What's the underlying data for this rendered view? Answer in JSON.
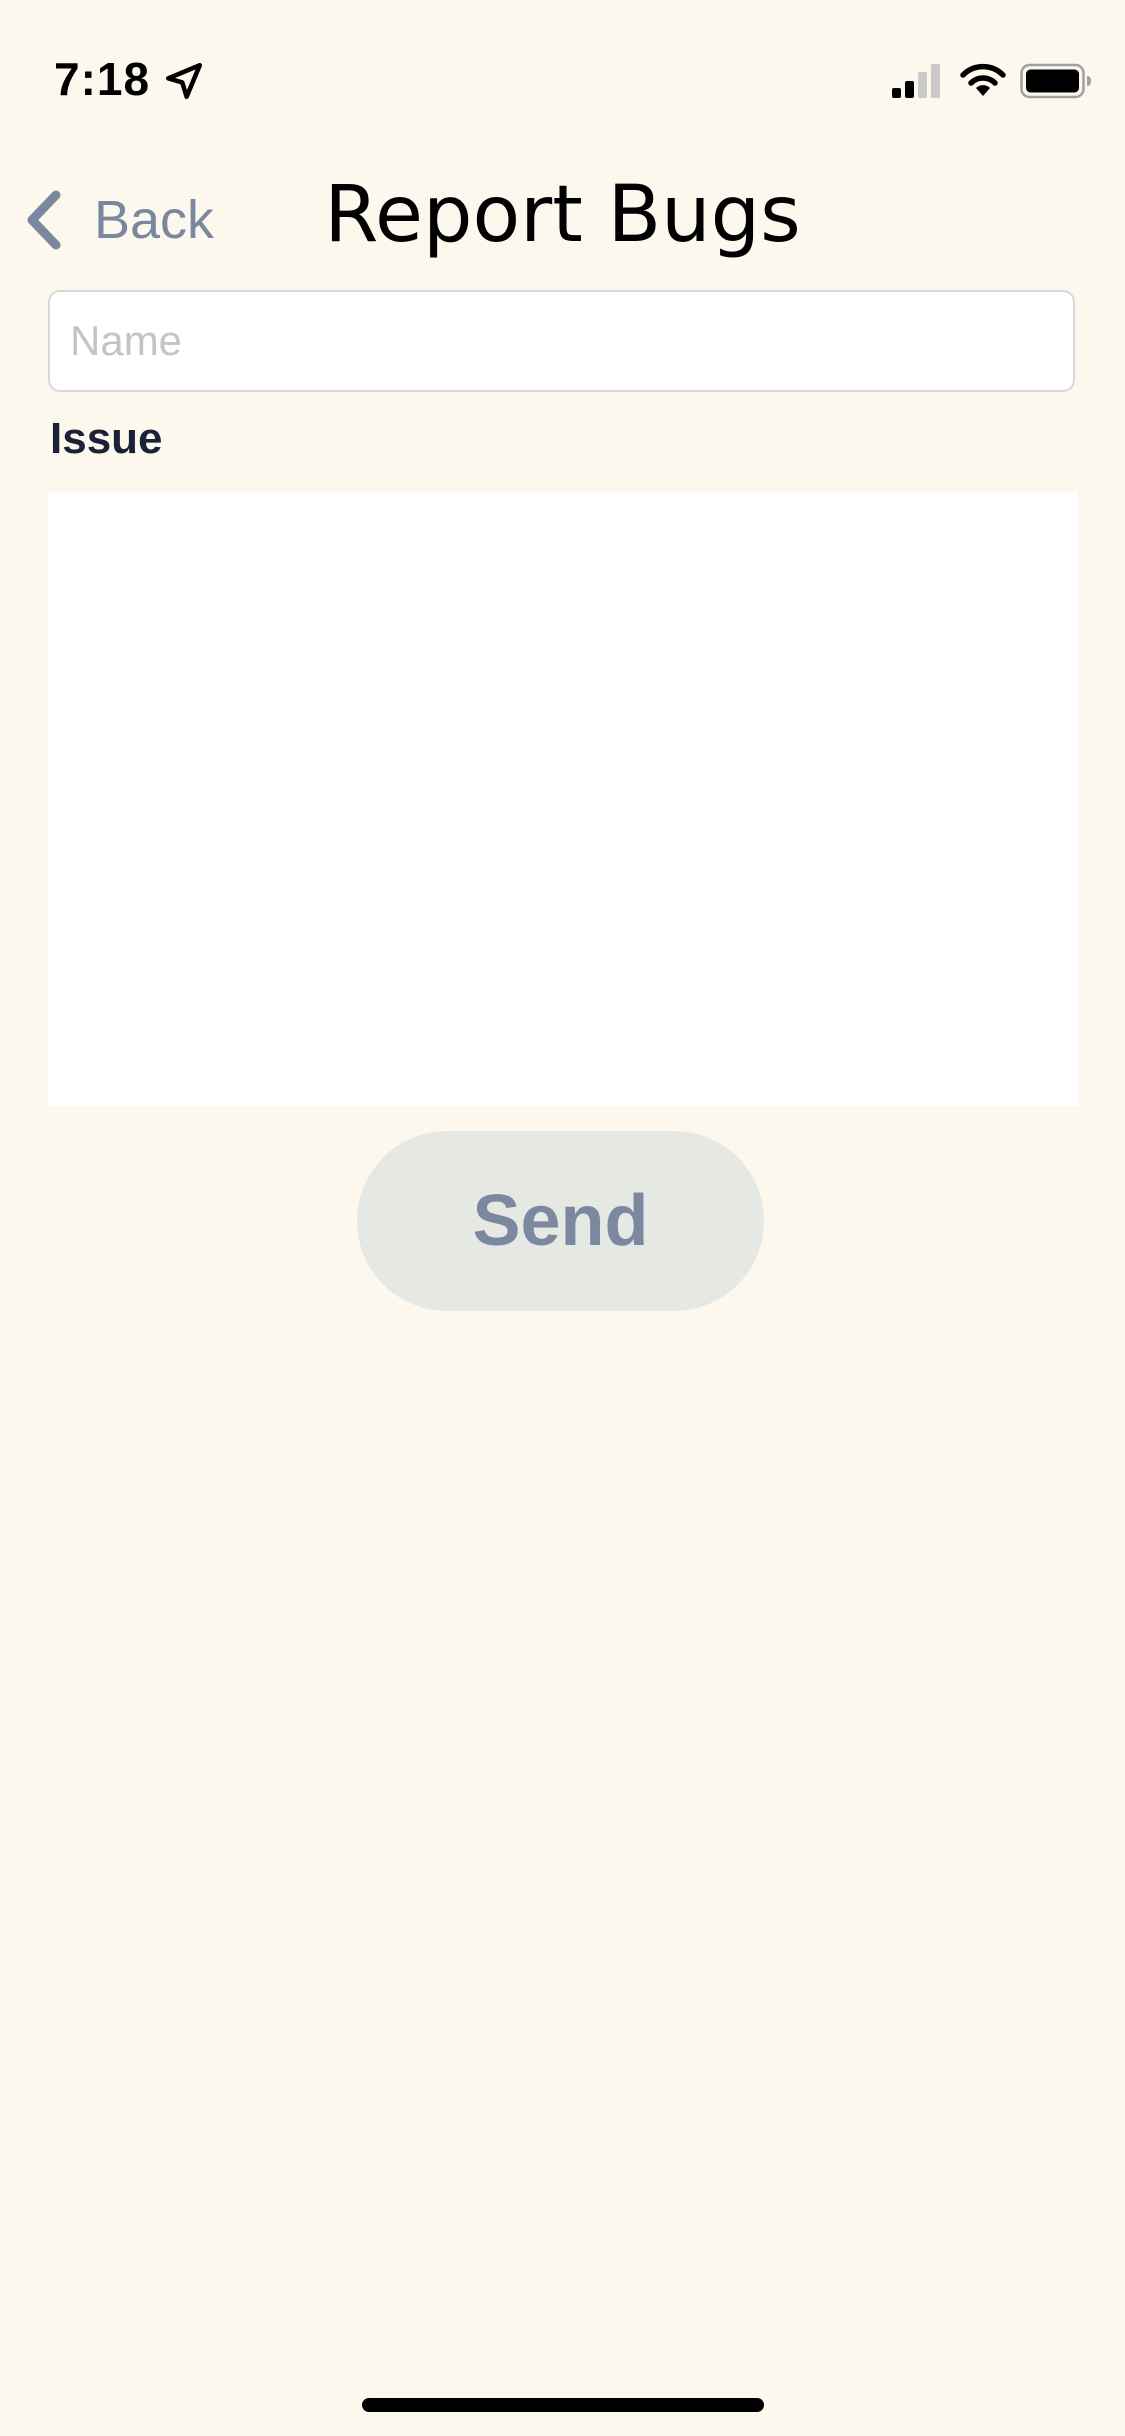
{
  "status_bar": {
    "time": "7:18",
    "icons": [
      "location-arrow-icon",
      "cellular-signal-icon",
      "wifi-icon",
      "battery-icon"
    ]
  },
  "nav": {
    "back_label": "Back",
    "title": "Report Bugs"
  },
  "form": {
    "name_placeholder": "Name",
    "name_value": "",
    "issue_label": "Issue",
    "issue_value": "",
    "send_label": "Send"
  },
  "colors": {
    "background": "#FCF8EE",
    "back_accent": "#7A879E",
    "label_text": "#1B2238",
    "send_bg": "#E5E8E3",
    "send_text": "#7C889F"
  }
}
